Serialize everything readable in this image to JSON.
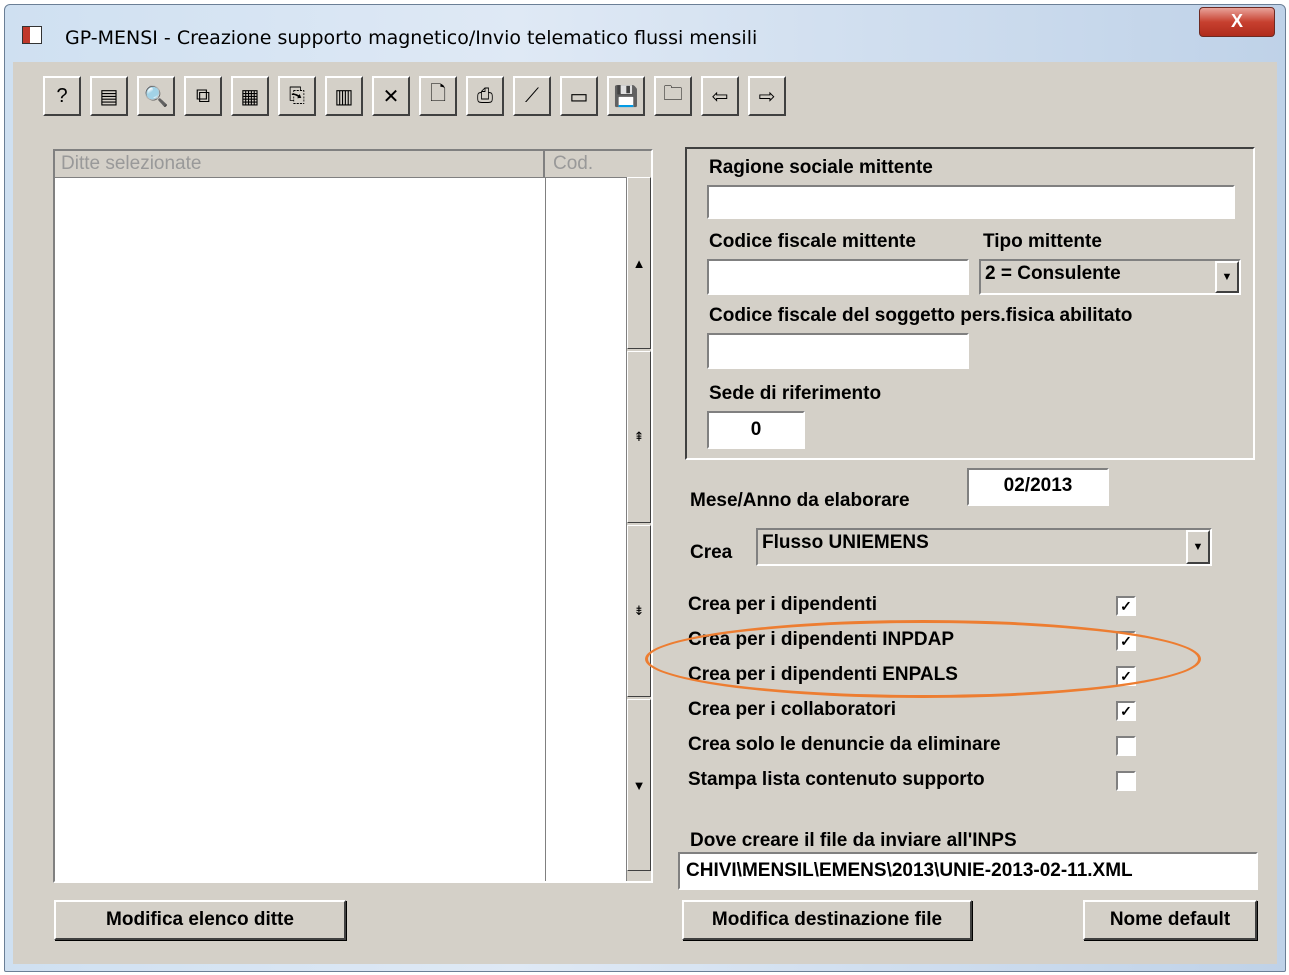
{
  "window": {
    "title": "GP-MENSI - Creazione supporto magnetico/Invio telematico flussi mensili",
    "close_label": "X"
  },
  "toolbar": {
    "buttons": [
      {
        "icon": "help-icon",
        "glyph": "?"
      },
      {
        "icon": "properties-icon",
        "glyph": "▤"
      },
      {
        "icon": "binoculars-icon",
        "glyph": "🔍"
      },
      {
        "icon": "copy-records-icon",
        "glyph": "⧉"
      },
      {
        "icon": "calculator-icon",
        "glyph": "▦"
      },
      {
        "icon": "copy-icon",
        "glyph": "⎘"
      },
      {
        "icon": "grid-icon",
        "glyph": "▥"
      },
      {
        "icon": "delete-icon",
        "glyph": "✕"
      },
      {
        "icon": "preview-icon",
        "glyph": "🗋"
      },
      {
        "icon": "print-icon",
        "glyph": "⎙"
      },
      {
        "icon": "pdf-icon",
        "glyph": "⟋"
      },
      {
        "icon": "edit-icon",
        "glyph": "▭"
      },
      {
        "icon": "save-icon",
        "glyph": "💾"
      },
      {
        "icon": "open-folder-icon",
        "glyph": "🗀"
      },
      {
        "icon": "arrow-left-icon",
        "glyph": "⇦"
      },
      {
        "icon": "arrow-right-icon",
        "glyph": "⇨"
      }
    ]
  },
  "list": {
    "col_company": "Ditte selezionate",
    "col_code": "Cod."
  },
  "form": {
    "ragione_label": "Ragione sociale mittente",
    "ragione_value": "",
    "cf_mittente_label": "Codice fiscale mittente",
    "cf_mittente_value": "",
    "tipo_label": "Tipo mittente",
    "tipo_value": "2 = Consulente",
    "cf_soggetto_label": "Codice fiscale del soggetto pers.fisica abilitato",
    "cf_soggetto_value": "",
    "sede_label": "Sede di riferimento",
    "sede_value": "0",
    "mese_label": "Mese/Anno da elaborare",
    "mese_value": "02/2013",
    "crea_label": "Crea",
    "crea_value": "Flusso UNIEMENS"
  },
  "options": [
    {
      "label": "Crea per i dipendenti",
      "checked": true
    },
    {
      "label": "Crea per i dipendenti INPDAP",
      "checked": true
    },
    {
      "label": "Crea per i dipendenti ENPALS",
      "checked": true
    },
    {
      "label": "Crea per i collaboratori",
      "checked": true
    },
    {
      "label": "Crea solo le denuncie da eliminare",
      "checked": false
    },
    {
      "label": "Stampa lista contenuto supporto",
      "checked": false
    }
  ],
  "output": {
    "label": "Dove creare il file da inviare all'INPS",
    "path": "CHIVI\\MENSIL\\EMENS\\2013\\UNIE-2013-02-11.XML"
  },
  "buttons": {
    "modify_list": "Modifica elenco ditte",
    "modify_dest": "Modifica destinazione file",
    "default_name": "Nome default"
  },
  "colors": {
    "highlight": "#ed7d31",
    "window_face": "#d4d0c8"
  }
}
